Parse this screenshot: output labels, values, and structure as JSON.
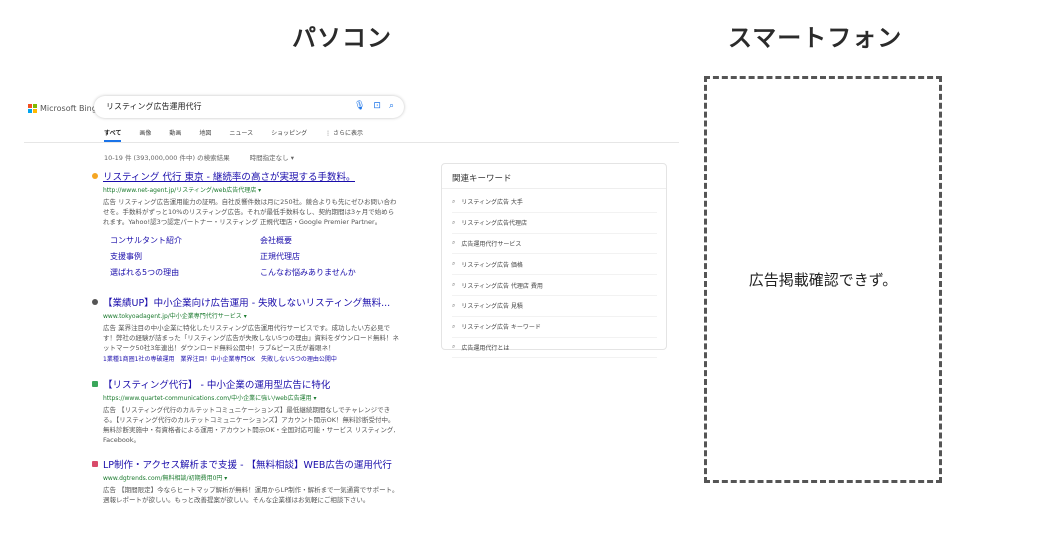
{
  "pc_title": "パソコン",
  "sp_title": "スマートフォン",
  "sp_message": "広告掲載確認できず。",
  "serp": {
    "logo_text": "Microsoft Bing",
    "query": "リスティング広告運用代行",
    "tabs": [
      "すべて",
      "画像",
      "動画",
      "地図",
      "ニュース",
      "ショッピング",
      "⋮ さらに表示"
    ],
    "result_count": "10-19 件 (393,000,000 件中) の検索結果",
    "time_filter": "時間指定なし ▾",
    "results": [
      {
        "title": "リスティング 代行 東京 - 継続率の高さが実現する手数料。",
        "url": "http://www.net-agent.jp/リスティング/web広告代理店 ▾",
        "desc": "広告 リスティング広告運用能力の証明。自社反響件数は月に250社。競合よりも先にゼひお問い合わせを。手数料がずっと10%のリスティング広告。それが最低手数料なし、契約期間は3ヶ月で始められます。Yahoo!認3つ認定パートナー・リスティング 正規代理店・Google Premier Partner。",
        "sitelinks": [
          "コンサルタント紹介",
          "会社概要",
          "支援事例",
          "正規代理店",
          "選ばれる5つの理由",
          "こんなお悩みありませんか"
        ]
      },
      {
        "title": "【業績UP】中小企業向け広告運用 - 失敗しないリスティング無料...",
        "url": "www.tokyoadagent.jp/中小企業専門代行サービス ▾",
        "desc": "広告 業界注目の中小企業に特化したリスティング広告運用代行サービスです。成功したい方必見です！弊社の経験が詰まった「リスティング広告が失敗しない5つの理由」資料をダウンロード無料！ネットマーク50社3年連出！ダウンロード無料公開中！ラブ&ピース氏が着眼ネ！",
        "extra": "1業種1商圏1社の専破運用　業界注目！中小企業専門OK　失敗しない5つの理由公開中"
      },
      {
        "title": "【リスティング代行】 - 中小企業の運用型広告に特化",
        "url": "https://www.quartet-communications.com/中小企業に強い/web広告運用 ▾",
        "desc": "広告 【リスティング代行のカルテットコミュニケーションズ】最低継続期間なしでチャレンジできる。【リスティング代行のカルテットコミュニケーションズ】アカウント開示OK！無料診断受付中。無料診断実施中・有資格者による運用・アカウント開示OK・全国対応可能・サービス リスティング, Facebook。"
      },
      {
        "title": "LP制作・アクセス解析まで支援 - 【無料相談】WEB広告の運用代行",
        "url": "www.dgtrends.com/無料相談/初期費用0円 ▾",
        "desc": "広告 【期間限定】今ならヒートマップ解析が無料！運用からLP制作・解析まで一気通貫でサポート。週報レポートが欲しい。もっと改善提案が欲しい。そんな企業様はお気軽にご相談下さい。"
      }
    ],
    "related": {
      "title": "関連キーワード",
      "items": [
        "リスティング広告 大手",
        "リスティング広告代理店",
        "広告運用代行サービス",
        "リスティング広告 価格",
        "リスティング広告 代理店 費用",
        "リスティング広告 見積",
        "リスティング広告 キーワード",
        "広告運用代行とは"
      ]
    }
  },
  "colors": {
    "link": "#1a0dab",
    "url": "#1b7a2e",
    "accent": "#1a73e8"
  }
}
